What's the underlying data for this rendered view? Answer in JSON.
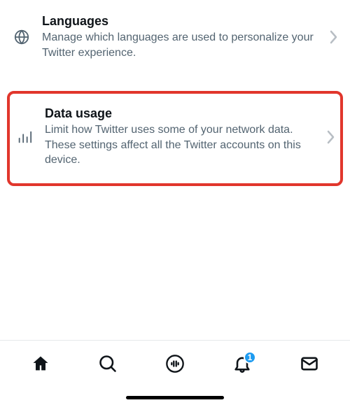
{
  "settings": {
    "languages": {
      "title": "Languages",
      "desc": "Manage which languages are used to personalize your Twitter experience."
    },
    "dataUsage": {
      "title": "Data usage",
      "desc": "Limit how Twitter uses some of your network data. These settings affect all the Twitter accounts on this device."
    }
  },
  "tabbar": {
    "notificationBadge": "1"
  }
}
